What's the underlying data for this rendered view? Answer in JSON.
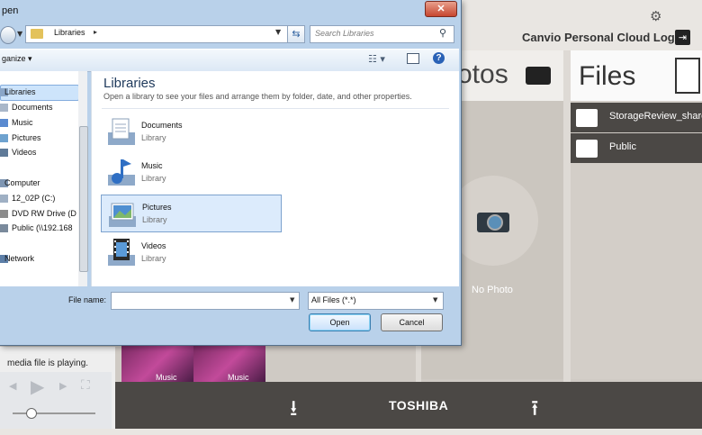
{
  "app": {
    "header_title": "Canvio Personal Cloud Login",
    "photos_title": "otos",
    "files_title": "Files",
    "no_photo": "No Photo",
    "files": [
      "StorageReview_share",
      "Public"
    ],
    "brand": "TOSHIBA"
  },
  "media_player": {
    "status": "media file is playing.",
    "thumbs": [
      "Music",
      "Music"
    ]
  },
  "dialog": {
    "title": "pen",
    "close_label": "✕",
    "address": "Libraries",
    "search_placeholder": "Search Libraries",
    "organize_label": "ganize ▾",
    "nav": {
      "libraries": "Libraries",
      "documents": "Documents",
      "music": "Music",
      "pictures": "Pictures",
      "videos": "Videos",
      "computer": "Computer",
      "drive_c": "12_02P (C:)",
      "dvd": "DVD RW Drive (D",
      "public": "Public (\\\\192.168",
      "network": "Network"
    },
    "heading": "Libraries",
    "subheading": "Open a library to see your files and arrange them by folder, date, and other properties.",
    "libraries": [
      {
        "name": "Documents",
        "type": "Library"
      },
      {
        "name": "Music",
        "type": "Library"
      },
      {
        "name": "Pictures",
        "type": "Library"
      },
      {
        "name": "Videos",
        "type": "Library"
      }
    ],
    "file_name_label": "File name:",
    "file_name_value": "",
    "file_type": "All Files (*.*)",
    "open_label": "Open",
    "cancel_label": "Cancel"
  },
  "colors": {
    "dark_panel": "#4b4845",
    "dialog_frame": "#b9d1ea",
    "selection": "#dcebfc"
  }
}
